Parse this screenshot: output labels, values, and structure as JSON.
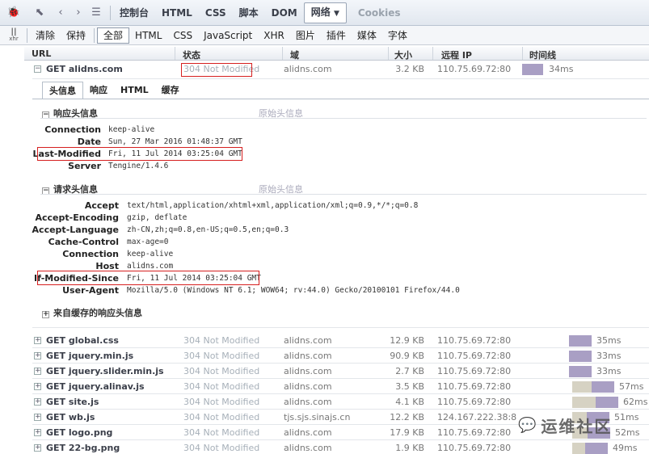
{
  "toolbar": {
    "tabs": [
      "控制台",
      "HTML",
      "CSS",
      "脚本",
      "DOM",
      "网络",
      "Cookies"
    ],
    "active_tab": "网络"
  },
  "filters": {
    "xhr_icon_label": "xhr",
    "items": [
      "清除",
      "保持",
      "全部",
      "HTML",
      "CSS",
      "JavaScript",
      "XHR",
      "图片",
      "插件",
      "媒体",
      "字体"
    ]
  },
  "columns": [
    "URL",
    "状态",
    "域",
    "大小",
    "远程 IP",
    "时间线"
  ],
  "main_request": {
    "url": "GET alidns.com",
    "status": "304 Not Modified",
    "domain": "alidns.com",
    "size": "3.2 KB",
    "ip": "110.75.69.72:80",
    "time": "34ms",
    "subtabs": [
      "头信息",
      "响应",
      "HTML",
      "缓存"
    ],
    "response_section": "响应头信息",
    "request_section": "请求头信息",
    "raw_label": "原始头信息",
    "cache_section": "来自缓存的响应头信息",
    "response_headers": [
      {
        "k": "Connection",
        "v": "keep-alive"
      },
      {
        "k": "Date",
        "v": "Sun, 27 Mar 2016 01:48:37 GMT"
      },
      {
        "k": "Last-Modified",
        "v": "Fri, 11 Jul 2014 03:25:04 GMT"
      },
      {
        "k": "Server",
        "v": "Tengine/1.4.6"
      }
    ],
    "request_headers": [
      {
        "k": "Accept",
        "v": "text/html,application/xhtml+xml,application/xml;q=0.9,*/*;q=0.8"
      },
      {
        "k": "Accept-Encoding",
        "v": "gzip, deflate"
      },
      {
        "k": "Accept-Language",
        "v": "zh-CN,zh;q=0.8,en-US;q=0.5,en;q=0.3"
      },
      {
        "k": "Cache-Control",
        "v": "max-age=0"
      },
      {
        "k": "Connection",
        "v": "keep-alive"
      },
      {
        "k": "Host",
        "v": "alidns.com"
      },
      {
        "k": "If-Modified-Since",
        "v": "Fri, 11 Jul 2014 03:25:04 GMT"
      },
      {
        "k": "User-Agent",
        "v": "Mozilla/5.0 (Windows NT 6.1; WOW64; rv:44.0) Gecko/20100101 Firefox/44.0"
      }
    ]
  },
  "requests": [
    {
      "url": "GET global.css",
      "status": "304 Not Modified",
      "domain": "alidns.com",
      "size": "12.9 KB",
      "ip": "110.75.69.72:80",
      "time": "35ms"
    },
    {
      "url": "GET jquery.min.js",
      "status": "304 Not Modified",
      "domain": "alidns.com",
      "size": "90.9 KB",
      "ip": "110.75.69.72:80",
      "time": "33ms"
    },
    {
      "url": "GET jquery.slider.min.js",
      "status": "304 Not Modified",
      "domain": "alidns.com",
      "size": "2.7 KB",
      "ip": "110.75.69.72:80",
      "time": "33ms"
    },
    {
      "url": "GET jquery.alinav.js",
      "status": "304 Not Modified",
      "domain": "alidns.com",
      "size": "3.5 KB",
      "ip": "110.75.69.72:80",
      "time": "57ms"
    },
    {
      "url": "GET site.js",
      "status": "304 Not Modified",
      "domain": "alidns.com",
      "size": "4.1 KB",
      "ip": "110.75.69.72:80",
      "time": "62ms"
    },
    {
      "url": "GET wb.js",
      "status": "304 Not Modified",
      "domain": "tjs.sjs.sinajs.cn",
      "size": "12.2 KB",
      "ip": "124.167.222.38:8",
      "time": "51ms"
    },
    {
      "url": "GET logo.png",
      "status": "304 Not Modified",
      "domain": "alidns.com",
      "size": "17.9 KB",
      "ip": "110.75.69.72:80",
      "time": "52ms"
    },
    {
      "url": "GET 22-bg.png",
      "status": "304 Not Modified",
      "domain": "alidns.com",
      "size": "1.9 KB",
      "ip": "110.75.69.72:80",
      "time": "49ms"
    }
  ],
  "watermark": "运维社区",
  "colors": {
    "bar": "#a99fc4",
    "bar_wait": "#d6d2c3",
    "highlight": "#d61f1f"
  }
}
